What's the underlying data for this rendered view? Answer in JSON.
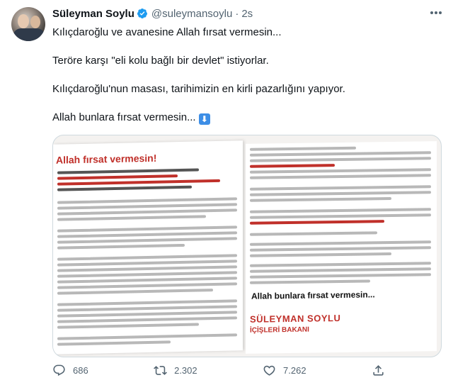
{
  "author": {
    "display_name": "Süleyman Soylu",
    "handle": "@suleymansoylu",
    "separator": "·",
    "time": "2s"
  },
  "tweet": {
    "lines": [
      "Kılıçdaroğlu ve avanesine Allah fırsat vermesin...",
      "Teröre karşı \"eli kolu bağlı bir devlet\" istiyorlar.",
      "Kılıçdaroğlu'nun masası, tarihimizin en kirli pazarlığını yapıyor.",
      "Allah bunlara fırsat vermesin..."
    ],
    "emoji": "⬇"
  },
  "media": {
    "doc_title": "Allah fırsat vermesin!",
    "doc_heading": "Allah bunlara fırsat vermesin...",
    "signature_name": "SÜLEYMAN SOYLU",
    "signature_role": "İÇİŞLERİ BAKANI"
  },
  "actions": {
    "reply_count": "686",
    "retweet_count": "2.302",
    "like_count": "7.262"
  },
  "colors": {
    "accent": "#1d9bf0",
    "secondary_text": "#536471",
    "doc_red": "#c0302a"
  },
  "icons": [
    "verified-badge-icon",
    "more-icon",
    "reply-icon",
    "retweet-icon",
    "like-icon",
    "share-icon",
    "down-arrow-emoji-icon"
  ]
}
